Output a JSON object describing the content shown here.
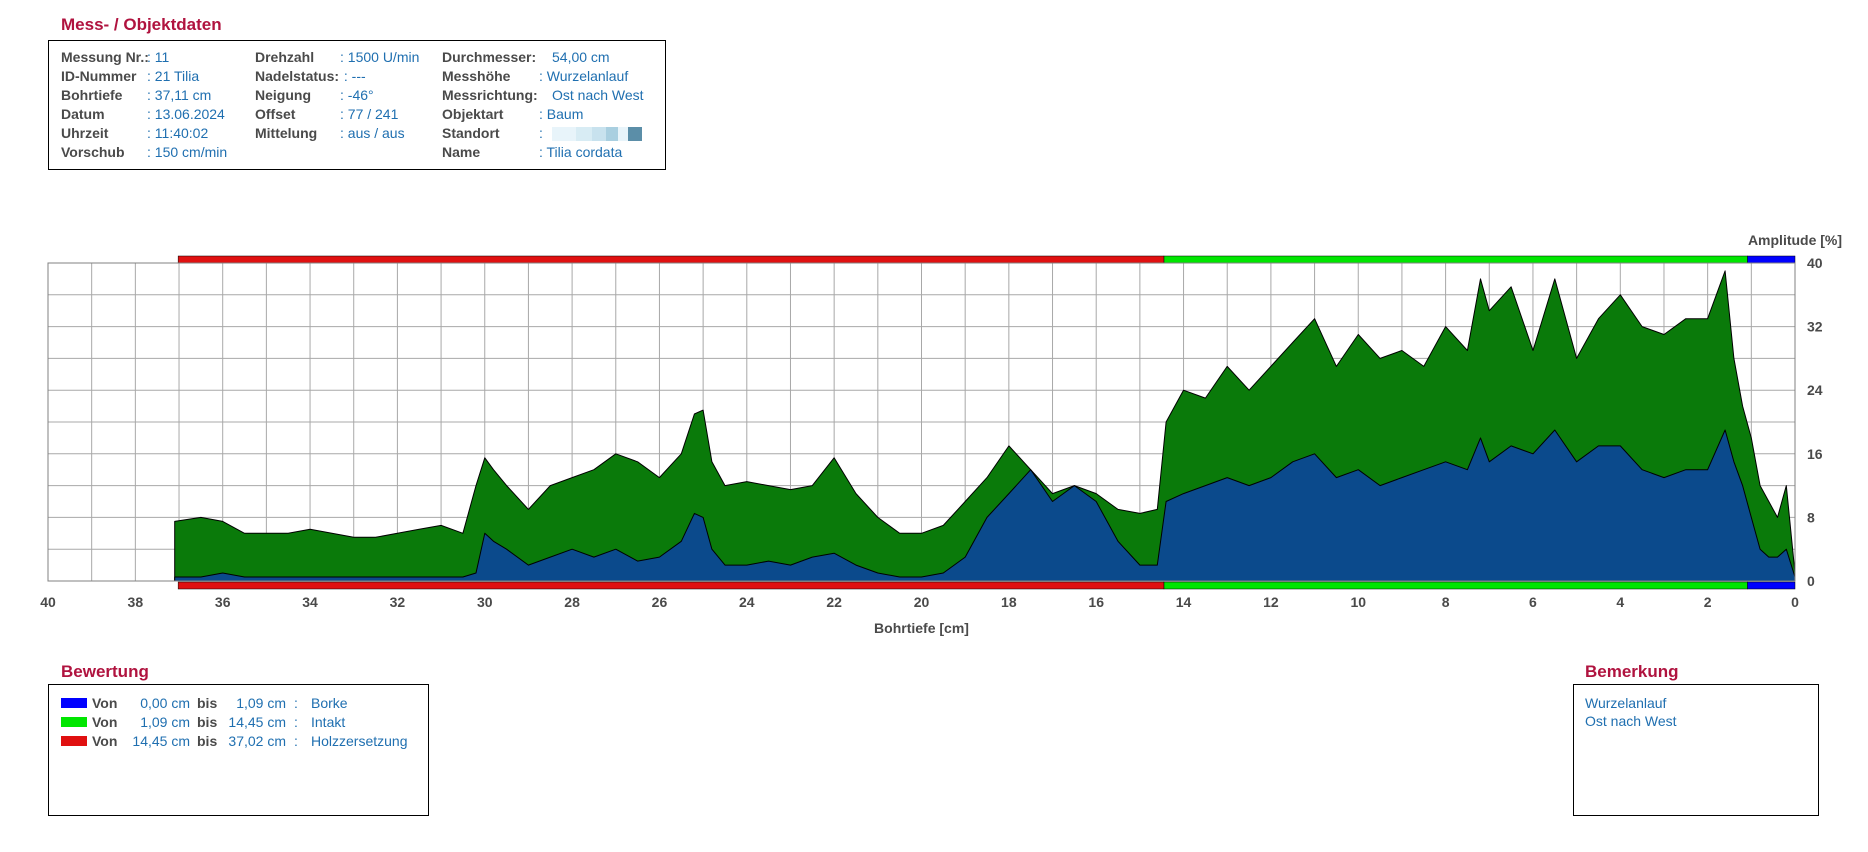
{
  "header": {
    "title": "Mess- / Objektdaten",
    "fields": [
      {
        "label": "Messung Nr.",
        "value": ": 11"
      },
      {
        "label": "ID-Nummer",
        "value": ": 21 Tilia"
      },
      {
        "label": "Bohrtiefe",
        "value": ": 37,11 cm"
      },
      {
        "label": "Datum",
        "value": ": 13.06.2024"
      },
      {
        "label": "Uhrzeit",
        "value": ": 11:40:02"
      },
      {
        "label": "Vorschub",
        "value": ": 150 cm/min"
      },
      {
        "label": "Drehzahl",
        "value": ": 1500 U/min"
      },
      {
        "label": "Nadelstatus",
        "value": ": ---"
      },
      {
        "label": "Neigung",
        "value": ": -46°"
      },
      {
        "label": "Offset",
        "value": ": 77 / 241"
      },
      {
        "label": "Mittelung",
        "value": ": aus / aus"
      },
      {
        "label": "Durchmesser",
        "value": "54,00 cm"
      },
      {
        "label": "Messhöhe",
        "value": ": Wurzelanlauf"
      },
      {
        "label": "Messrichtung",
        "value": "Ost nach West"
      },
      {
        "label": "Objektart",
        "value": ": Baum"
      },
      {
        "label": "Standort",
        "value": ":"
      },
      {
        "label": "Name",
        "value": ": Tilia cordata"
      }
    ],
    "label_suffix": {
      "Messung Nr.": ":",
      "Nadelstatus": ":",
      "Durchmesser": ":",
      "Messrichtung": ":"
    },
    "standort_colors": [
      "#e8f4fa",
      "#d8ecf4",
      "#c8e2ee",
      "#a9cfe0",
      "#e8f4fa",
      "#5b8ea8"
    ]
  },
  "chart_data": {
    "type": "area",
    "xlabel": "Bohrtiefe [cm]",
    "ylabel": "Amplitude [%]",
    "xlim": [
      40,
      0
    ],
    "ylim": [
      0,
      40
    ],
    "x_ticks": [
      40,
      38,
      36,
      34,
      32,
      30,
      28,
      26,
      24,
      22,
      20,
      18,
      16,
      14,
      12,
      10,
      8,
      6,
      4,
      2,
      0
    ],
    "y_ticks": [
      0,
      8,
      16,
      24,
      32,
      40
    ],
    "grid": true,
    "zones": [
      {
        "from": 0,
        "to": 1.09,
        "color": "#0000ff"
      },
      {
        "from": 1.09,
        "to": 14.45,
        "color": "#00e600"
      },
      {
        "from": 14.45,
        "to": 37.02,
        "color": "#e01010"
      }
    ],
    "series": [
      {
        "color": "#0a7a0a",
        "x": [
          37.1,
          36.5,
          36,
          35.5,
          35,
          34.5,
          34,
          33.5,
          33,
          32.5,
          32,
          31.5,
          31,
          30.5,
          30.2,
          30,
          29.8,
          29.5,
          29,
          28.5,
          28,
          27.5,
          27,
          26.5,
          26,
          25.5,
          25.2,
          25,
          24.8,
          24.5,
          24,
          23.5,
          23,
          22.5,
          22,
          21.5,
          21,
          20.5,
          20,
          19.5,
          19,
          18.5,
          18,
          17.5,
          17,
          16.5,
          16,
          15.5,
          15,
          14.6,
          14.4,
          14,
          13.5,
          13,
          12.5,
          12,
          11.5,
          11,
          10.5,
          10,
          9.5,
          9,
          8.5,
          8,
          7.5,
          7.2,
          7,
          6.5,
          6,
          5.5,
          5,
          4.5,
          4,
          3.5,
          3,
          2.5,
          2,
          1.6,
          1.4,
          1.2,
          1,
          0.8,
          0.6,
          0.4,
          0.2,
          0
        ],
        "values": [
          7.5,
          8,
          7.5,
          6,
          6,
          6,
          6.5,
          6,
          5.5,
          5.5,
          6,
          6.5,
          7,
          6,
          12,
          15.5,
          14,
          12,
          9,
          12,
          13,
          14,
          16,
          15,
          13,
          16,
          21,
          21.5,
          15,
          12,
          12.5,
          12,
          11.5,
          12,
          15.5,
          11,
          8,
          6,
          6,
          7,
          10,
          13,
          17,
          14,
          11,
          12,
          11,
          9,
          8.5,
          9,
          20,
          24,
          23,
          27,
          24,
          27,
          30,
          33,
          27,
          31,
          28,
          29,
          27,
          32,
          29,
          38,
          34,
          37,
          29,
          38,
          28,
          33,
          36,
          32,
          31,
          33,
          33,
          39,
          28,
          22,
          18,
          12,
          10,
          8,
          12,
          1
        ]
      },
      {
        "color": "#0b4a8c",
        "x": [
          37.1,
          36.5,
          36,
          35.5,
          35,
          34.5,
          34,
          33.5,
          33,
          32.5,
          32,
          31.5,
          31,
          30.5,
          30.2,
          30,
          29.8,
          29.5,
          29,
          28.5,
          28,
          27.5,
          27,
          26.5,
          26,
          25.5,
          25.2,
          25,
          24.8,
          24.5,
          24,
          23.5,
          23,
          22.5,
          22,
          21.5,
          21,
          20.5,
          20,
          19.5,
          19,
          18.5,
          18,
          17.5,
          17,
          16.5,
          16,
          15.5,
          15,
          14.6,
          14.4,
          14,
          13.5,
          13,
          12.5,
          12,
          11.5,
          11,
          10.5,
          10,
          9.5,
          9,
          8.5,
          8,
          7.5,
          7.2,
          7,
          6.5,
          6,
          5.5,
          5,
          4.5,
          4,
          3.5,
          3,
          2.5,
          2,
          1.6,
          1.4,
          1.2,
          1,
          0.8,
          0.6,
          0.4,
          0.2,
          0
        ],
        "values": [
          0.5,
          0.5,
          1,
          0.5,
          0.5,
          0.5,
          0.5,
          0.5,
          0.5,
          0.5,
          0.5,
          0.5,
          0.5,
          0.5,
          1,
          6,
          5,
          4,
          2,
          3,
          4,
          3,
          4,
          2.5,
          3,
          5,
          8.5,
          8,
          4,
          2,
          2,
          2.5,
          2,
          3,
          3.5,
          2,
          1,
          0.5,
          0.5,
          1,
          3,
          8,
          11,
          14,
          10,
          12,
          10,
          5,
          2,
          2,
          10,
          11,
          12,
          13,
          12,
          13,
          15,
          16,
          13,
          14,
          12,
          13,
          14,
          15,
          14,
          18,
          15,
          17,
          16,
          19,
          15,
          17,
          17,
          14,
          13,
          14,
          14,
          19,
          15,
          12,
          8,
          4,
          3,
          3,
          4,
          0.5
        ]
      }
    ]
  },
  "bewertung": {
    "title": "Bewertung",
    "rows": [
      {
        "color": "#0000ff",
        "von": "Von",
        "from": "0,00 cm",
        "bis": "bis",
        "to": "1,09 cm",
        "colon": ":",
        "text": "Borke"
      },
      {
        "color": "#00e600",
        "von": "Von",
        "from": "1,09 cm",
        "bis": "bis",
        "to": "14,45 cm",
        "colon": ":",
        "text": "Intakt"
      },
      {
        "color": "#e01010",
        "von": "Von",
        "from": "14,45 cm",
        "bis": "bis",
        "to": "37,02 cm",
        "colon": ":",
        "text": "Holzzersetzung"
      }
    ]
  },
  "bemerkung": {
    "title": "Bemerkung",
    "lines": [
      "Wurzelanlauf",
      "Ost nach West"
    ]
  }
}
